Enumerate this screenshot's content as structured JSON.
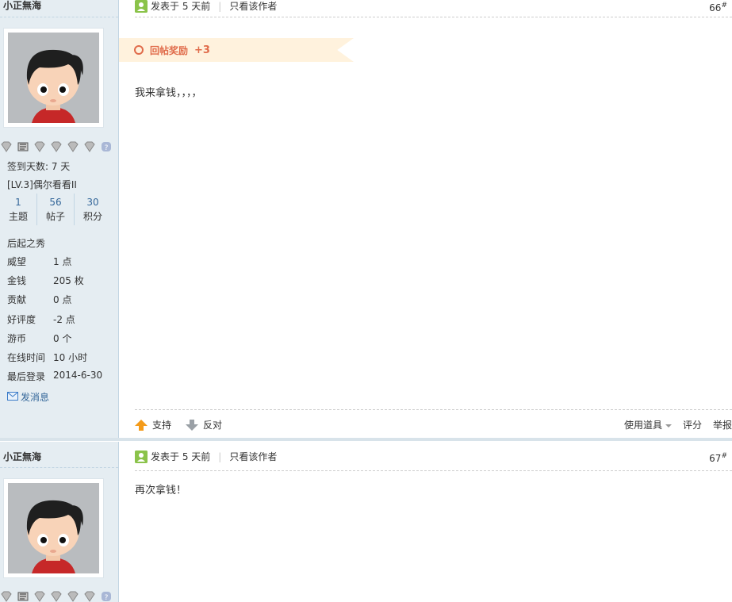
{
  "posts": [
    {
      "author": "小正無海",
      "meta": {
        "posted": "发表于 5 天前",
        "only_author": "只看该作者"
      },
      "floor": "66",
      "reward": {
        "label": "回帖奖励",
        "amount": "+3"
      },
      "content": "我来拿钱，，，，",
      "signin": "签到天数: 7 天",
      "level": "[LV.3]偶尔看看II",
      "counts": [
        {
          "num": "1",
          "label": "主题"
        },
        {
          "num": "56",
          "label": "帖子"
        },
        {
          "num": "30",
          "label": "积分"
        }
      ],
      "rank": "后起之秀",
      "stats": [
        {
          "k": "威望",
          "v": "1 点"
        },
        {
          "k": "金钱",
          "v": "205 枚"
        },
        {
          "k": "贡献",
          "v": "0 点"
        },
        {
          "k": "好评度",
          "v": "-2 点"
        },
        {
          "k": "游币",
          "v": "0 个"
        },
        {
          "k": "在线时间",
          "v": "10 小时"
        },
        {
          "k": "最后登录",
          "v": "2014-6-30"
        }
      ],
      "pm": "发消息",
      "footer": {
        "support": "支持",
        "oppose": "反对",
        "use_tool": "使用道具",
        "rate": "评分",
        "report": "举报"
      }
    },
    {
      "author": "小正無海",
      "meta": {
        "posted": "发表于 5 天前",
        "only_author": "只看该作者"
      },
      "floor": "67",
      "content": "再次拿钱！"
    }
  ],
  "colors": {
    "link": "#336699",
    "reward": "#e06b4a",
    "sidebar_bg": "#e5edf2"
  },
  "icons": [
    "online-status-icon",
    "medal-icon",
    "help-icon",
    "thumb-up-arrow-icon",
    "thumb-down-arrow-icon",
    "mail-icon"
  ]
}
